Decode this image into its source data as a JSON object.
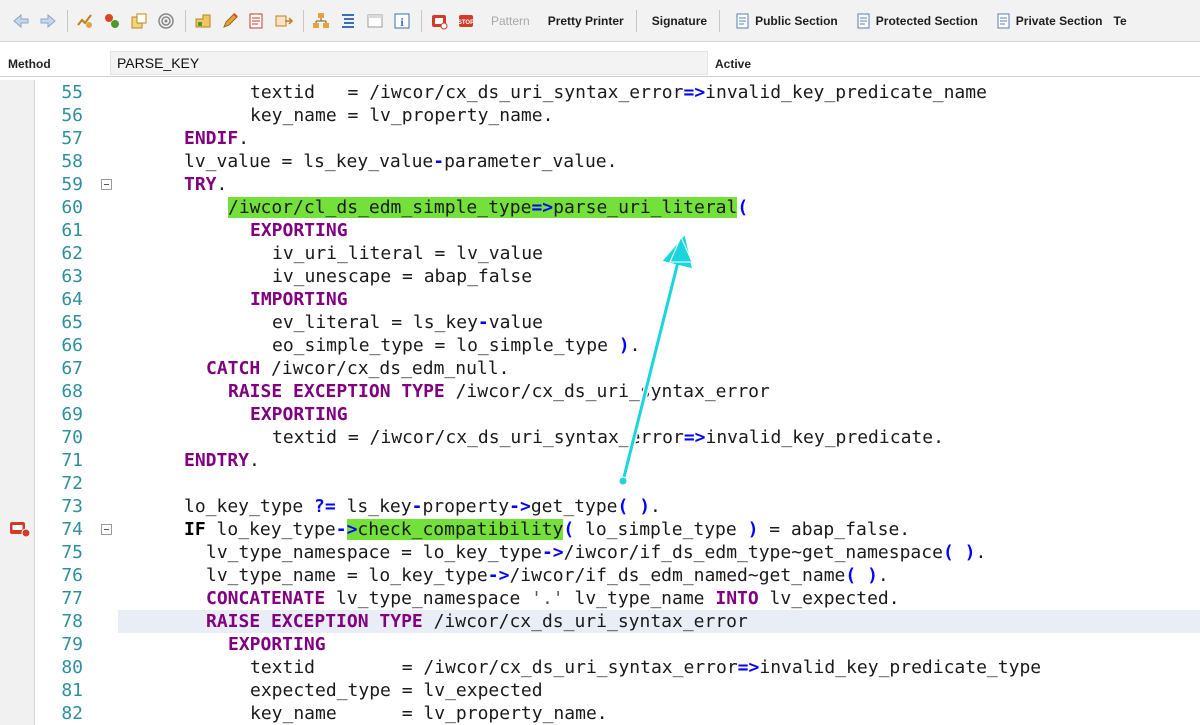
{
  "toolbar": {
    "icons": [
      "back-icon",
      "forward-icon",
      "check-syntax-icon",
      "activate-icon",
      "where-used-icon",
      "navigate-icon",
      "display-object-list-icon",
      "edit-icon",
      "insert-statement-icon",
      "pattern-icon-2",
      "hierarchy-icon",
      "outline-icon",
      "fullscreen-icon",
      "info-icon",
      "breakpoint-session-icon",
      "breakpoint-external-icon"
    ],
    "pattern_label": "Pattern",
    "pretty_printer_label": "Pretty Printer",
    "signature_label": "Signature",
    "public_section_label": "Public Section",
    "protected_section_label": "Protected Section",
    "private_section_label": "Private Section",
    "truncated_label": "Te"
  },
  "method_bar": {
    "label": "Method",
    "value": "PARSE_KEY",
    "status": "Active"
  },
  "editor": {
    "breakpoint_line": "74",
    "current_line": "78",
    "fold_lines": [
      "59",
      "74"
    ],
    "lines": [
      {
        "no": "55",
        "indent": 12,
        "tokens": [
          {
            "t": "textid   = /iwcor/cx_ds_uri_syntax_error"
          },
          {
            "t": "=>",
            "c": "op"
          },
          {
            "t": "invalid_key_predicate_name"
          }
        ]
      },
      {
        "no": "56",
        "indent": 12,
        "tokens": [
          {
            "t": "key_name = lv_property_name."
          }
        ]
      },
      {
        "no": "57",
        "indent": 6,
        "tokens": [
          {
            "t": "ENDIF",
            "c": "kw"
          },
          {
            "t": "."
          }
        ]
      },
      {
        "no": "58",
        "indent": 6,
        "tokens": [
          {
            "t": "lv_value = ls_key_value"
          },
          {
            "t": "-",
            "c": "op"
          },
          {
            "t": "parameter_value."
          }
        ]
      },
      {
        "no": "59",
        "indent": 6,
        "tokens": [
          {
            "t": "TRY",
            "c": "kw"
          },
          {
            "t": "."
          }
        ]
      },
      {
        "no": "60",
        "indent": 10,
        "tokens": [
          {
            "t": "/iwcor/cl_ds_edm_simple_type",
            "c": "hl"
          },
          {
            "t": "=>",
            "c": "op hl"
          },
          {
            "t": "parse_uri_literal",
            "c": "hl"
          },
          {
            "t": "(",
            "c": "op"
          }
        ]
      },
      {
        "no": "61",
        "indent": 12,
        "tokens": [
          {
            "t": "EXPORTING",
            "c": "kw"
          }
        ]
      },
      {
        "no": "62",
        "indent": 14,
        "tokens": [
          {
            "t": "iv_uri_literal = lv_value"
          }
        ]
      },
      {
        "no": "63",
        "indent": 14,
        "tokens": [
          {
            "t": "iv_unescape = abap_false"
          }
        ]
      },
      {
        "no": "64",
        "indent": 12,
        "tokens": [
          {
            "t": "IMPORTING",
            "c": "kw"
          }
        ]
      },
      {
        "no": "65",
        "indent": 14,
        "tokens": [
          {
            "t": "ev_literal = ls_key"
          },
          {
            "t": "-",
            "c": "op"
          },
          {
            "t": "value"
          }
        ]
      },
      {
        "no": "66",
        "indent": 14,
        "tokens": [
          {
            "t": "eo_simple_type = lo_simple_type "
          },
          {
            "t": ")",
            "c": "op"
          },
          {
            "t": "."
          }
        ]
      },
      {
        "no": "67",
        "indent": 8,
        "tokens": [
          {
            "t": "CATCH",
            "c": "kw"
          },
          {
            "t": " /iwcor/cx_ds_edm_null."
          }
        ]
      },
      {
        "no": "68",
        "indent": 10,
        "tokens": [
          {
            "t": "RAISE EXCEPTION TYPE",
            "c": "kw"
          },
          {
            "t": " /iwcor/cx_ds_uri_syntax_error"
          }
        ]
      },
      {
        "no": "69",
        "indent": 12,
        "tokens": [
          {
            "t": "EXPORTING",
            "c": "kw"
          }
        ]
      },
      {
        "no": "70",
        "indent": 14,
        "tokens": [
          {
            "t": "textid = /iwcor/cx_ds_uri_syntax_error"
          },
          {
            "t": "=>",
            "c": "op"
          },
          {
            "t": "invalid_key_predicate."
          }
        ]
      },
      {
        "no": "71",
        "indent": 6,
        "tokens": [
          {
            "t": "ENDTRY",
            "c": "kw"
          },
          {
            "t": "."
          }
        ]
      },
      {
        "no": "72",
        "indent": 0,
        "tokens": []
      },
      {
        "no": "73",
        "indent": 6,
        "tokens": [
          {
            "t": "lo_key_type "
          },
          {
            "t": "?=",
            "c": "op"
          },
          {
            "t": " ls_key"
          },
          {
            "t": "-",
            "c": "op"
          },
          {
            "t": "property"
          },
          {
            "t": "->",
            "c": "op"
          },
          {
            "t": "get_type"
          },
          {
            "t": "( )",
            "c": "op"
          },
          {
            "t": "."
          }
        ]
      },
      {
        "no": "74",
        "indent": 6,
        "tokens": [
          {
            "t": "IF",
            "c": "kwb"
          },
          {
            "t": " lo_key_type"
          },
          {
            "t": "-",
            "c": "op"
          },
          {
            "t": ">",
            "c": "op hl"
          },
          {
            "t": "check_compatibility",
            "c": "hl"
          },
          {
            "t": "(",
            "c": "op"
          },
          {
            "t": " lo_simple_type "
          },
          {
            "t": ")",
            "c": "op"
          },
          {
            "t": " = abap_false."
          }
        ]
      },
      {
        "no": "75",
        "indent": 8,
        "tokens": [
          {
            "t": "lv_type_namespace = lo_key_type"
          },
          {
            "t": "->",
            "c": "op"
          },
          {
            "t": "/iwcor/if_ds_edm_type~get_namespace"
          },
          {
            "t": "( )",
            "c": "op"
          },
          {
            "t": "."
          }
        ]
      },
      {
        "no": "76",
        "indent": 8,
        "tokens": [
          {
            "t": "lv_type_name = lo_key_type"
          },
          {
            "t": "->",
            "c": "op"
          },
          {
            "t": "/iwcor/if_ds_edm_named~get_name"
          },
          {
            "t": "( )",
            "c": "op"
          },
          {
            "t": "."
          }
        ]
      },
      {
        "no": "77",
        "indent": 8,
        "tokens": [
          {
            "t": "CONCATENATE",
            "c": "kw"
          },
          {
            "t": " lv_type_namespace "
          },
          {
            "t": "'.'",
            "c": "str"
          },
          {
            "t": " lv_type_name "
          },
          {
            "t": "INTO",
            "c": "kw"
          },
          {
            "t": " lv_expected."
          }
        ]
      },
      {
        "no": "78",
        "indent": 8,
        "tokens": [
          {
            "t": "RAISE EXCEPTION TYPE",
            "c": "kw"
          },
          {
            "t": " /iwcor/cx_ds_uri_syntax_error"
          }
        ]
      },
      {
        "no": "79",
        "indent": 10,
        "tokens": [
          {
            "t": "EXPORTING",
            "c": "kw"
          }
        ]
      },
      {
        "no": "80",
        "indent": 12,
        "tokens": [
          {
            "t": "textid        = /iwcor/cx_ds_uri_syntax_error"
          },
          {
            "t": "=>",
            "c": "op"
          },
          {
            "t": "invalid_key_predicate_type"
          }
        ]
      },
      {
        "no": "81",
        "indent": 12,
        "tokens": [
          {
            "t": "expected_type = lv_expected"
          }
        ]
      },
      {
        "no": "82",
        "indent": 12,
        "tokens": [
          {
            "t": "key_name      = lv_property_name."
          }
        ]
      }
    ]
  },
  "colors": {
    "highlight": "#74e03a",
    "keyword": "#800080",
    "operator": "#0000ff",
    "line_number": "#2f8f9c",
    "arrow": "#19d6dc"
  }
}
